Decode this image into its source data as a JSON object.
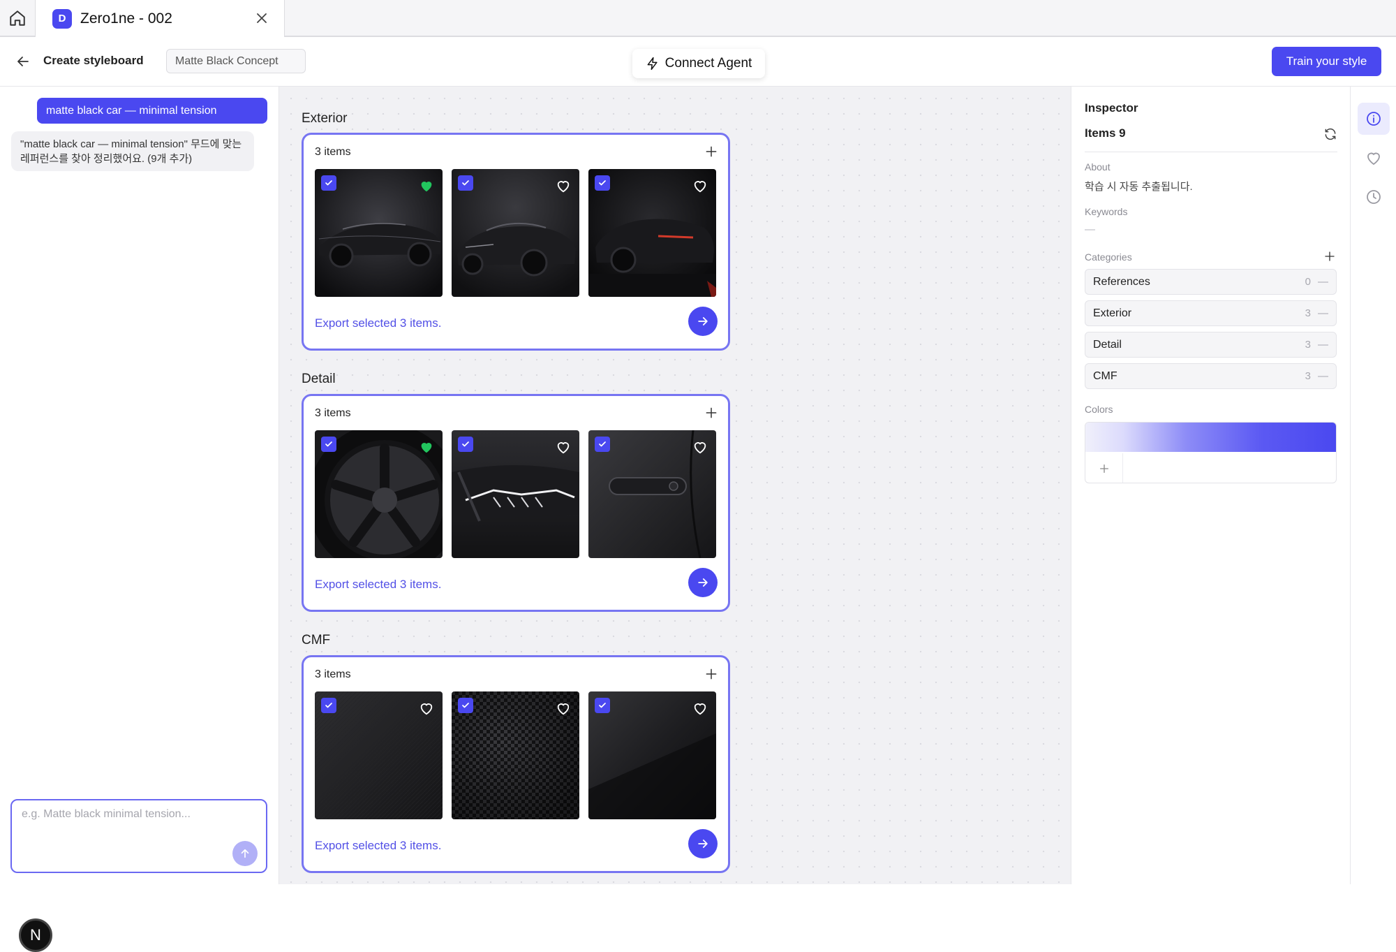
{
  "tab": {
    "badge": "D",
    "title": "Zero1ne - 002"
  },
  "header": {
    "page_title": "Create styleboard",
    "board_name": "Matte Black Concept",
    "connect_agent_label": "Connect Agent",
    "train_label": "Train your style"
  },
  "chat": {
    "user_message": "matte black car — minimal tension",
    "ai_message": "\"matte black car — minimal tension\" 무드에 맞는 레퍼런스를 찾아 정리했어요. (9개 추가)",
    "input_value": "",
    "input_placeholder": "e.g. Matte black minimal tension...",
    "avatar_letter": "N"
  },
  "sections": [
    {
      "title": "Exterior",
      "count_label": "3 items",
      "export_label": "Export selected 3 items.",
      "items": [
        {
          "kind": "car-side",
          "checked": true,
          "liked": true
        },
        {
          "kind": "car-front",
          "checked": true,
          "liked": false
        },
        {
          "kind": "car-rear",
          "checked": true,
          "liked": false
        }
      ]
    },
    {
      "title": "Detail",
      "count_label": "3 items",
      "export_label": "Export selected 3 items.",
      "items": [
        {
          "kind": "wheel",
          "checked": true,
          "liked": true
        },
        {
          "kind": "headlight",
          "checked": true,
          "liked": false
        },
        {
          "kind": "door-handle",
          "checked": true,
          "liked": false
        }
      ]
    },
    {
      "title": "CMF",
      "count_label": "3 items",
      "export_label": "Export selected 3 items.",
      "items": [
        {
          "kind": "matte-texture",
          "checked": true,
          "liked": false
        },
        {
          "kind": "carbon-weave",
          "checked": true,
          "liked": false
        },
        {
          "kind": "dark-surface",
          "checked": true,
          "liked": false
        }
      ]
    }
  ],
  "inspector": {
    "title": "Inspector",
    "items_label": "Items 9",
    "about_label": "About",
    "about_text": "학습 시 자동 추출됩니다.",
    "keywords_label": "Keywords",
    "keywords_text": "—",
    "categories_label": "Categories",
    "categories": [
      {
        "name": "References",
        "count": "0"
      },
      {
        "name": "Exterior",
        "count": "3"
      },
      {
        "name": "Detail",
        "count": "3"
      },
      {
        "name": "CMF",
        "count": "3"
      }
    ],
    "colors_label": "Colors",
    "minus_symbol": "—"
  },
  "rail": [
    "info-icon",
    "heart-icon",
    "history-icon"
  ],
  "colors": {
    "accent": "#4a48f0",
    "liked": "#22c55e",
    "card_border": "#7775f2"
  }
}
